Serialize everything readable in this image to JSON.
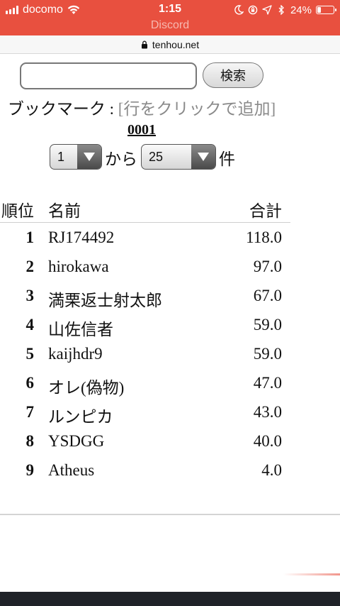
{
  "status_bar": {
    "carrier": "docomo",
    "time": "1:15",
    "battery": "24%",
    "battery_level": 0.24
  },
  "nav": {
    "title": "Discord"
  },
  "url_bar": {
    "domain": "tenhou.net"
  },
  "search": {
    "input_value": "",
    "button_label": "検索"
  },
  "bookmark": {
    "label": "ブックマーク : ",
    "hint": "[行をクリックで追加]"
  },
  "page_id": "0001",
  "range": {
    "from_value": "1",
    "between_label": "から",
    "to_value": "25",
    "unit_label": "件"
  },
  "table": {
    "headers": {
      "rank": "順位",
      "name": "名前",
      "total": "合計"
    },
    "rows": [
      {
        "rank": "1",
        "name": "RJ174492",
        "total": "118.0"
      },
      {
        "rank": "2",
        "name": "hirokawa",
        "total": "97.0"
      },
      {
        "rank": "3",
        "name": "満栗返士射太郎",
        "total": "67.0"
      },
      {
        "rank": "4",
        "name": "山佐信者",
        "total": "59.0"
      },
      {
        "rank": "5",
        "name": "kaijhdr9",
        "total": "59.0"
      },
      {
        "rank": "6",
        "name": "オレ(偽物)",
        "total": "47.0"
      },
      {
        "rank": "7",
        "name": "ルンピカ",
        "total": "43.0"
      },
      {
        "rank": "8",
        "name": "YSDGG",
        "total": "40.0"
      },
      {
        "rank": "9",
        "name": "Atheus",
        "total": "4.0"
      }
    ]
  },
  "colors": {
    "header_bg": "#e8503f",
    "hint_text": "#8a8a8a"
  }
}
